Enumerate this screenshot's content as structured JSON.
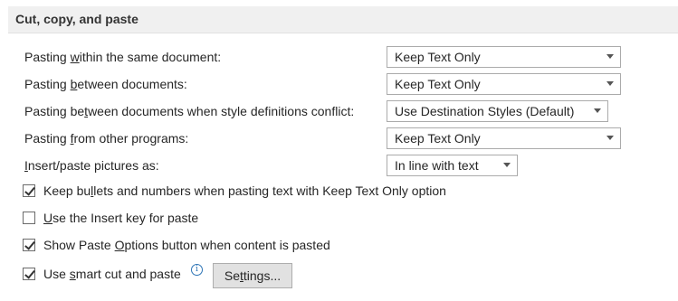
{
  "section": {
    "title": "Cut, copy, and paste"
  },
  "rows": [
    {
      "label_pre": "Pasting ",
      "label_ul": "w",
      "label_post": "ithin the same document:",
      "value": "Keep Text Only"
    },
    {
      "label_pre": "Pasting ",
      "label_ul": "b",
      "label_post": "etween documents:",
      "value": "Keep Text Only"
    },
    {
      "label_pre": "Pasting be",
      "label_ul": "t",
      "label_post": "ween documents when style definitions conflict:",
      "value": "Use Destination Styles (Default)"
    },
    {
      "label_pre": "Pasting ",
      "label_ul": "f",
      "label_post": "rom other programs:",
      "value": "Keep Text Only"
    },
    {
      "label_pre": "",
      "label_ul": "I",
      "label_post": "nsert/paste pictures as:",
      "value": "In line with text"
    }
  ],
  "checkboxes": [
    {
      "label_pre": "Keep bu",
      "label_ul": "l",
      "label_post": "lets and numbers when pasting text with Keep Text Only option",
      "checked": true
    },
    {
      "label_pre": "",
      "label_ul": "U",
      "label_post": "se the Insert key for paste",
      "checked": false
    },
    {
      "label_pre": "Show Paste ",
      "label_ul": "O",
      "label_post": "ptions button when content is pasted",
      "checked": true
    },
    {
      "label_pre": "Use ",
      "label_ul": "s",
      "label_post": "mart cut and paste",
      "checked": true
    }
  ],
  "info_icon": "info-icon",
  "settings_button": {
    "label_pre": "Se",
    "label_ul": "t",
    "label_post": "tings..."
  }
}
